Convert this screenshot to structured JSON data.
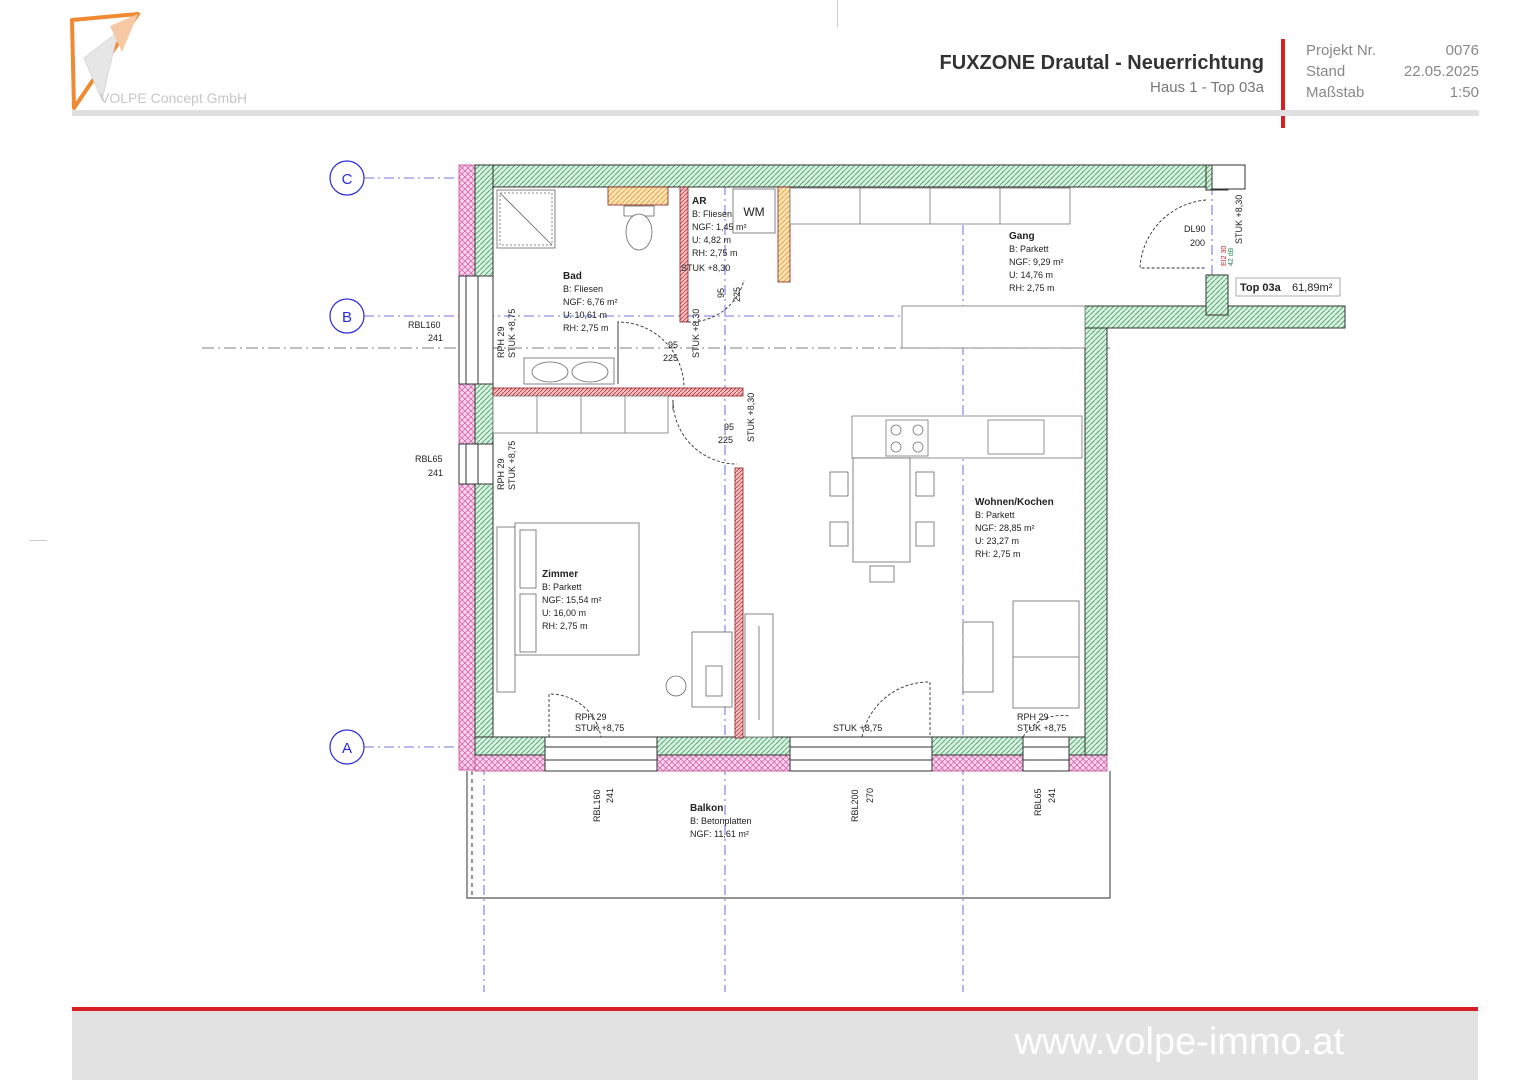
{
  "header": {
    "logo_text": "VOLPE Concept GmbH",
    "title": "FUXZONE Drautal - Neuerrichtung",
    "subtitle": "Haus 1 - Top 03a",
    "meta": [
      {
        "label": "Projekt Nr.",
        "value": "0076"
      },
      {
        "label": "Stand",
        "value": "22.05.2025"
      },
      {
        "label": "Maßstab",
        "value": "1:50"
      }
    ]
  },
  "axes": {
    "c": "C",
    "b": "B",
    "a": "A"
  },
  "rooms": {
    "bad": {
      "name": "Bad",
      "floor": "B: Fliesen",
      "ngf": "NGF: 6,76 m²",
      "u": "U: 10,61 m",
      "rh": "RH: 2,75 m"
    },
    "ar": {
      "name": "AR",
      "floor": "B: Fliesen",
      "ngf": "NGF: 1,45 m²",
      "u": "U: 4,82 m",
      "rh": "RH: 2,75 m"
    },
    "gang": {
      "name": "Gang",
      "floor": "B: Parkett",
      "ngf": "NGF: 9,29 m²",
      "u": "U: 14,76 m",
      "rh": "RH: 2,75 m"
    },
    "zimmer": {
      "name": "Zimmer",
      "floor": "B: Parkett",
      "ngf": "NGF: 15,54 m²",
      "u": "U: 16,00 m",
      "rh": "RH: 2,75 m"
    },
    "wohnen": {
      "name": "Wohnen/Kochen",
      "floor": "B: Parkett",
      "ngf": "NGF: 28,85 m²",
      "u": "U: 23,27 m",
      "rh": "RH: 2,75 m"
    },
    "balkon": {
      "name": "Balkon",
      "floor": "B: Betonplatten",
      "ngf": "NGF: 11,61 m²"
    }
  },
  "unit": {
    "name": "Top 03a",
    "area": "61,89m²"
  },
  "labels": {
    "wm": "WM",
    "dl90": "DL90",
    "dl90_h": "200",
    "stuk830": "STUK +8,30",
    "stuk875": "STUK +8,75",
    "rph29": "RPH 29",
    "d95": "95",
    "d225": "225",
    "rbl160": "RBL160",
    "rbl65": "RBL65",
    "rbl200": "RBL200",
    "h241": "241",
    "h270": "270",
    "ei2": "EI2 30",
    "ei2b": "42 dB"
  },
  "footer": {
    "url": "www.volpe-immo.at"
  },
  "colors": {
    "accent": "#d81e25",
    "wall_green": "#2e8b57",
    "wall_red": "#b5292e",
    "axis_blue": "#2a2ad8"
  }
}
